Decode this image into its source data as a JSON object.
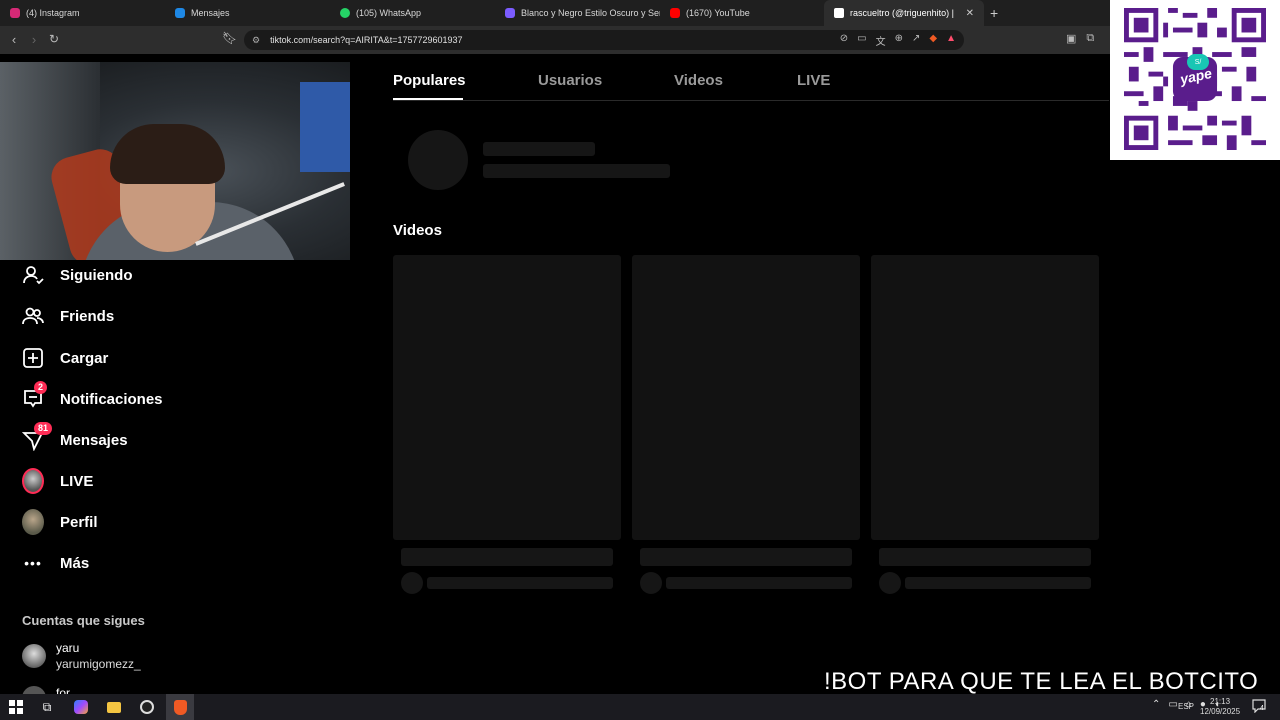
{
  "browser": {
    "tabs": [
      {
        "title": "(4) Instagram",
        "color": "#d62976",
        "active": false
      },
      {
        "title": "Mensajes",
        "color": "#1e88e5",
        "active": false
      },
      {
        "title": "(105) WhatsApp",
        "color": "#25d366",
        "active": false
      },
      {
        "title": "Blanco y Negro Estilo Oscuro y Serio",
        "color": "#7b5cff",
        "active": false
      },
      {
        "title": "(1670) YouTube",
        "color": "#ff0000",
        "active": false
      },
      {
        "title": "rascueltro (@triguenhito) | TikTo",
        "color": "#ffffff",
        "active": true
      }
    ],
    "url": "tiktok.com/search?q=AIRITA&t=1757729601937"
  },
  "qr": {
    "brand": "yape",
    "logo_text": "S/"
  },
  "sidebar": {
    "items": [
      {
        "label": "Siguiendo",
        "icon": "following-icon"
      },
      {
        "label": "Friends",
        "icon": "friends-icon"
      },
      {
        "label": "Cargar",
        "icon": "upload-icon"
      },
      {
        "label": "Notificaciones",
        "icon": "notifications-icon",
        "badge": "2"
      },
      {
        "label": "Mensajes",
        "icon": "messages-icon",
        "badge": "81"
      },
      {
        "label": "LIVE",
        "icon": "live-avatar"
      },
      {
        "label": "Perfil",
        "icon": "profile-avatar"
      },
      {
        "label": "Más",
        "icon": "more-icon"
      }
    ],
    "following_title": "Cuentas que sigues",
    "accounts": [
      {
        "name": "yaru",
        "handle": "yarumigomezz_"
      },
      {
        "name": "for",
        "handle": ""
      }
    ]
  },
  "content": {
    "tabs": [
      "Populares",
      "Usuarios",
      "Videos",
      "LIVE"
    ],
    "active_tab": "Populares",
    "videos_heading": "Videos"
  },
  "overlay": {
    "text": "!BOT PARA QUE TE LEA EL BOTCITO"
  },
  "taskbar": {
    "language": "ESP",
    "time": "21:13",
    "date": "12/09/2025",
    "notifications": "4"
  }
}
